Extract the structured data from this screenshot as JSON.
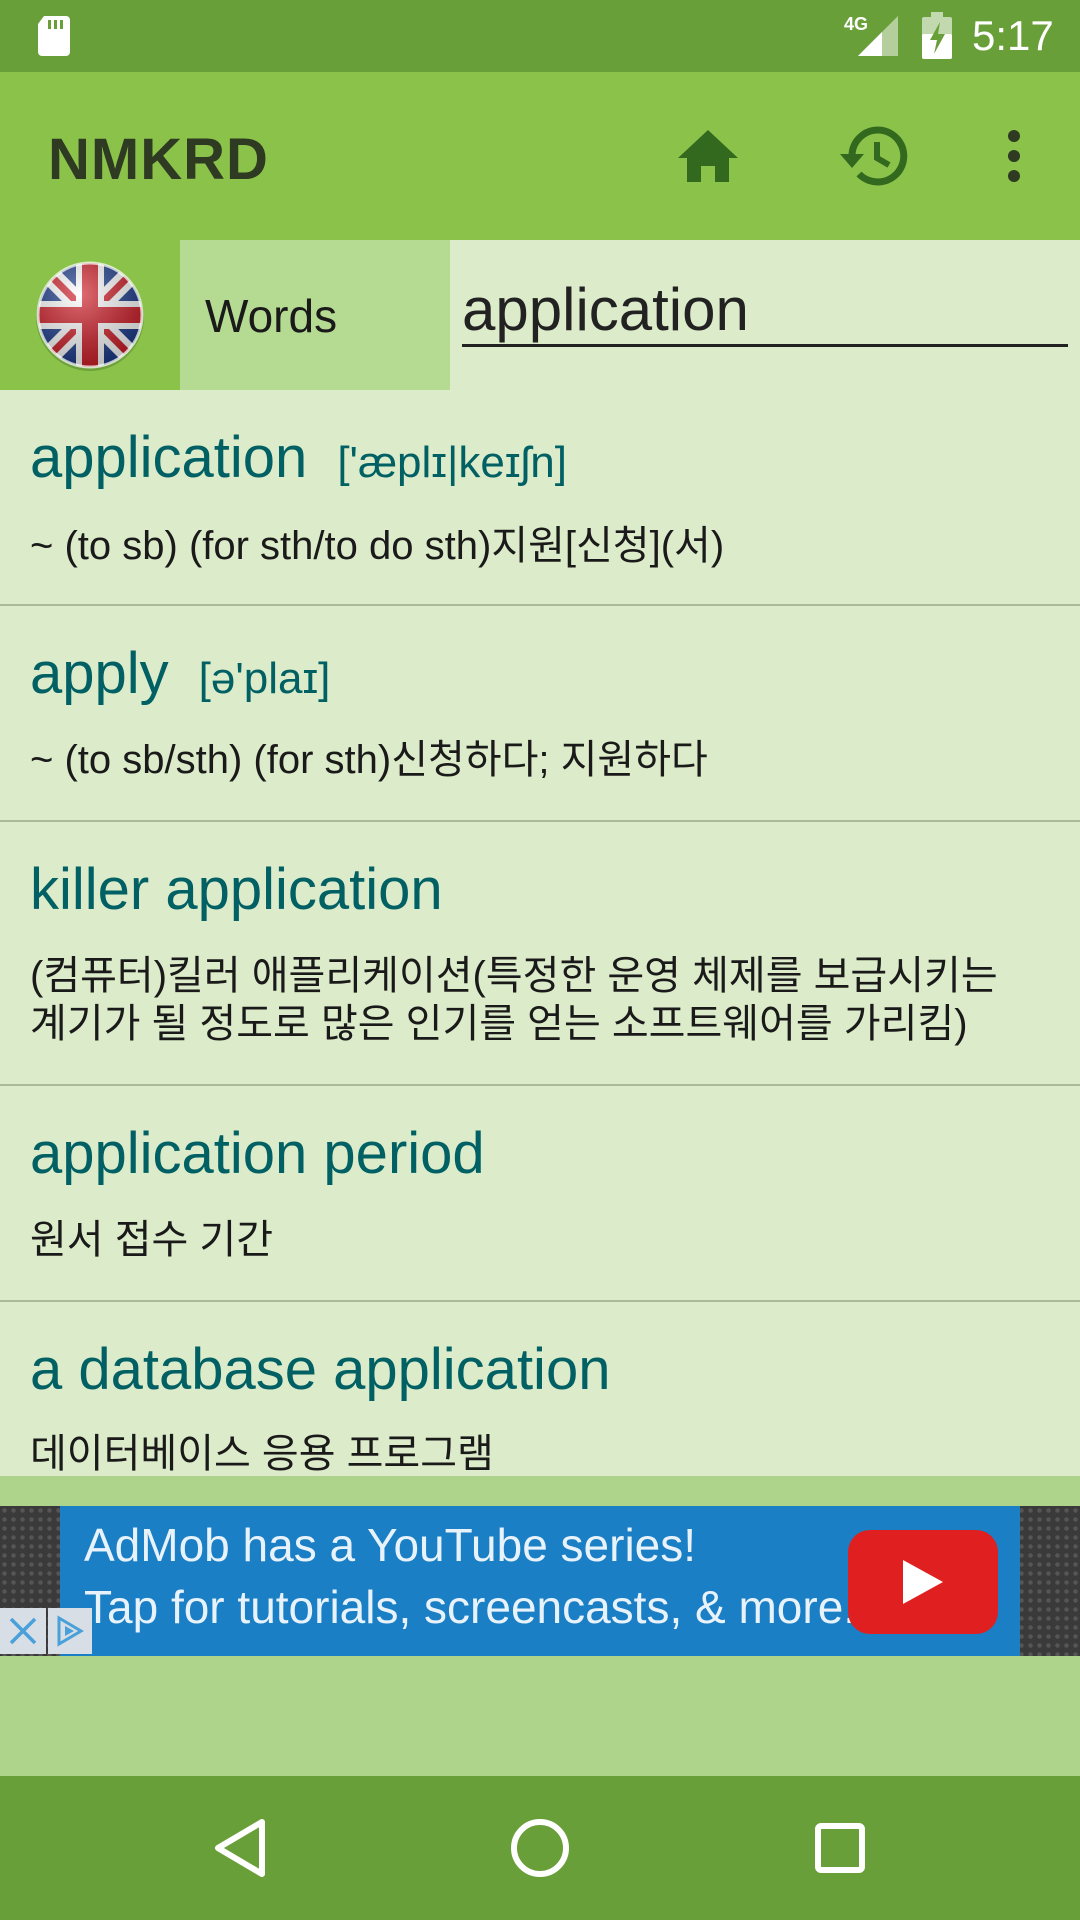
{
  "status_bar": {
    "time": "5:17",
    "network": "4G",
    "icons": [
      "sd-card-icon",
      "signal-icon",
      "battery-charging-icon"
    ]
  },
  "app_bar": {
    "title": "NMKRD",
    "actions": [
      "home-icon",
      "history-icon",
      "more-vert-icon"
    ],
    "color": "#8bc34a"
  },
  "search": {
    "language_icon": "uk-flag-icon",
    "mode_label": "Words",
    "query": "application"
  },
  "results": [
    {
      "word": "application",
      "phonetic": "['æplɪ|keɪʃn]",
      "definition": "~ (to sb) (for sth/to do sth)지원[신청](서)"
    },
    {
      "word": "apply",
      "phonetic": "[ə'plaɪ]",
      "definition": "~ (to sb/sth) (for sth)신청하다; 지원하다"
    },
    {
      "word": "killer application",
      "phonetic": "",
      "definition_lines": [
        "(컴퓨터)킬러 애플리케이션(특정한 운영 체제를 보급시키는",
        "계기가 될 정도로 많은 인기를 얻는 소프트웨어를 가리킴)"
      ]
    },
    {
      "word": "application period",
      "phonetic": "",
      "definition": "원서 접수 기간"
    },
    {
      "word": "a database application",
      "phonetic": "",
      "definition": "데이터베이스 응용 프로그램"
    }
  ],
  "ad": {
    "line1": "AdMob has a YouTube series!",
    "line2": "Tap for tutorials, screencasts, & more.",
    "play_icon": "youtube-play-icon",
    "close_icon": "close-icon",
    "adchoices_icon": "adchoices-icon"
  },
  "nav_bar": {
    "buttons": [
      "back-icon",
      "home-circle-icon",
      "recents-icon"
    ]
  },
  "colors": {
    "status_bar": "#689f38",
    "app_bar": "#8bc34a",
    "list_bg": "#dcebc9",
    "word_text": "#006064"
  }
}
